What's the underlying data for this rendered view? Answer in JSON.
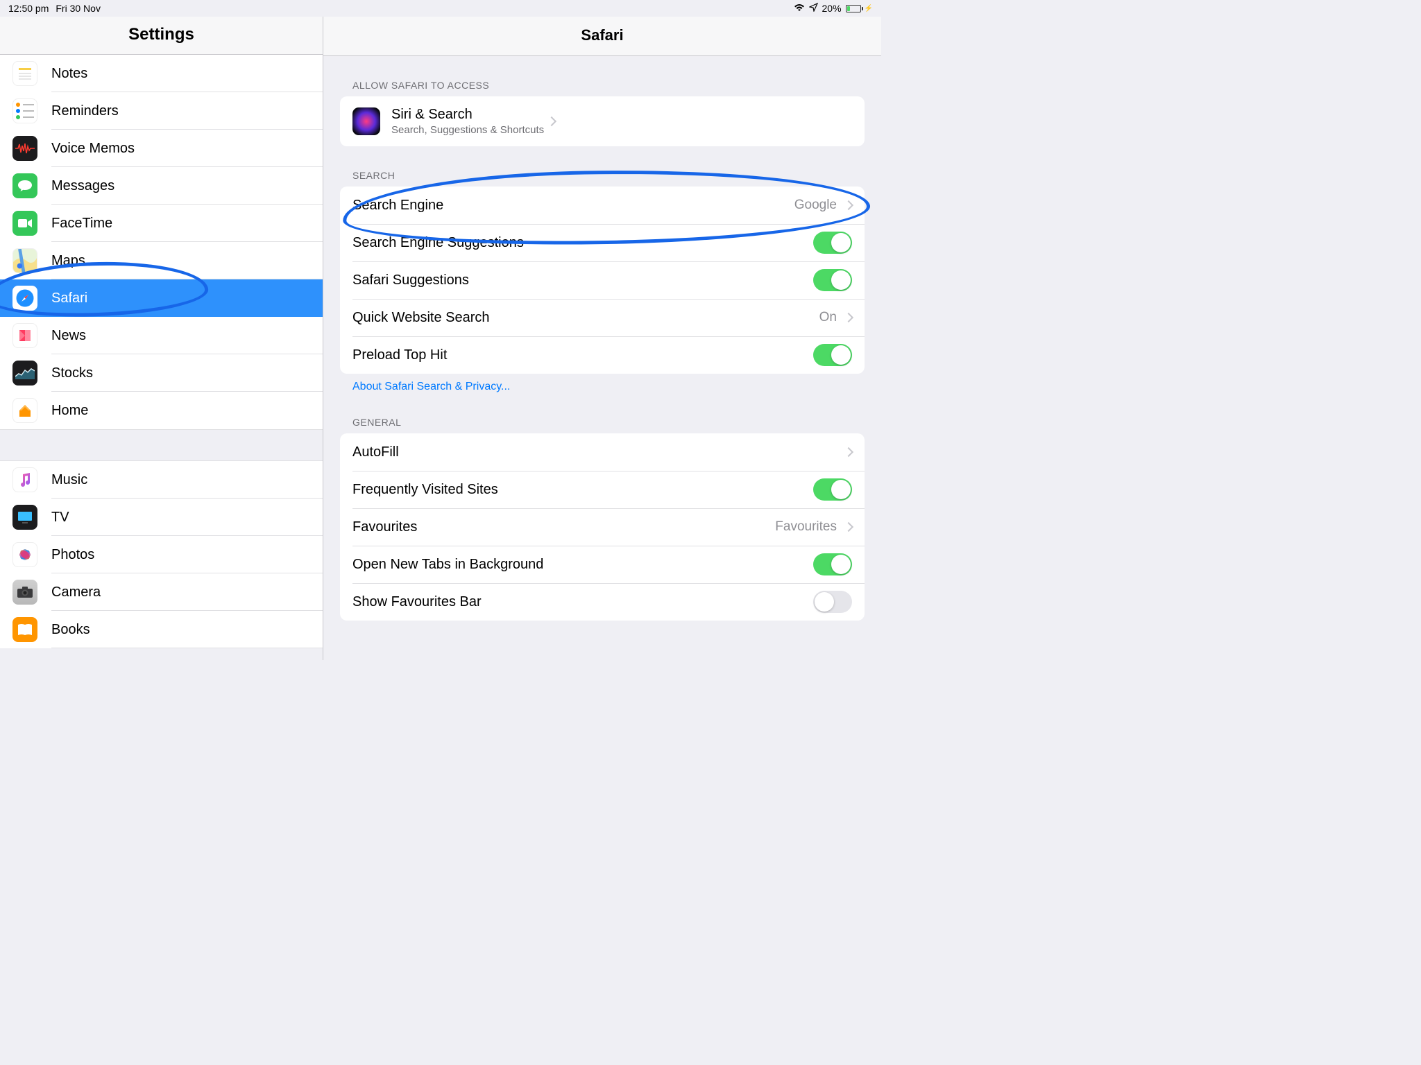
{
  "status": {
    "time": "12:50 pm",
    "date": "Fri 30 Nov",
    "battery_pct": "20%"
  },
  "sidebar": {
    "title": "Settings",
    "group1": [
      {
        "label": "Notes",
        "icon": "notes-icon"
      },
      {
        "label": "Reminders",
        "icon": "reminders-icon"
      },
      {
        "label": "Voice Memos",
        "icon": "voice-memos-icon"
      },
      {
        "label": "Messages",
        "icon": "messages-icon"
      },
      {
        "label": "FaceTime",
        "icon": "facetime-icon"
      },
      {
        "label": "Maps",
        "icon": "maps-icon"
      },
      {
        "label": "Safari",
        "icon": "safari-icon",
        "selected": true
      },
      {
        "label": "News",
        "icon": "news-icon"
      },
      {
        "label": "Stocks",
        "icon": "stocks-icon"
      },
      {
        "label": "Home",
        "icon": "home-icon"
      }
    ],
    "group2": [
      {
        "label": "Music",
        "icon": "music-icon"
      },
      {
        "label": "TV",
        "icon": "tv-icon"
      },
      {
        "label": "Photos",
        "icon": "photos-icon"
      },
      {
        "label": "Camera",
        "icon": "camera-icon"
      },
      {
        "label": "Books",
        "icon": "books-icon"
      }
    ]
  },
  "detail": {
    "title": "Safari",
    "allow_header": "Allow Safari to Access",
    "siri": {
      "title": "Siri & Search",
      "subtitle": "Search, Suggestions & Shortcuts"
    },
    "search_header": "Search",
    "search": {
      "engine_label": "Search Engine",
      "engine_value": "Google",
      "suggestions_label": "Search Engine Suggestions",
      "safari_suggestions_label": "Safari Suggestions",
      "quick_label": "Quick Website Search",
      "quick_value": "On",
      "preload_label": "Preload Top Hit"
    },
    "search_footer": "About Safari Search & Privacy...",
    "general_header": "General",
    "general": {
      "autofill": "AutoFill",
      "freq": "Frequently Visited Sites",
      "fav_label": "Favourites",
      "fav_value": "Favourites",
      "newtabs": "Open New Tabs in Background",
      "favbar": "Show Favourites Bar"
    }
  }
}
